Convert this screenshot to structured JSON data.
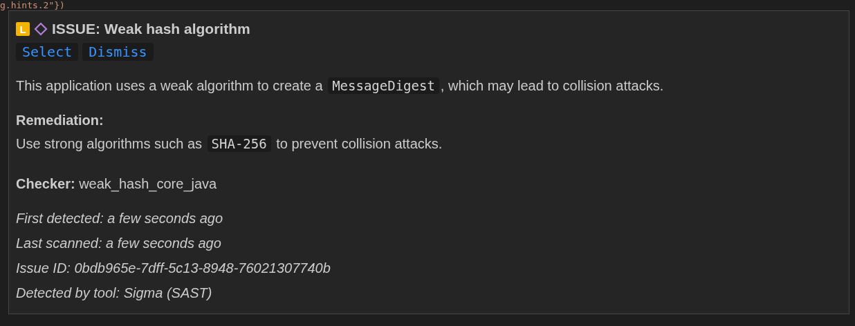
{
  "editor_code_line": "g.hints.2\"})",
  "hover": {
    "severity_badge": "L",
    "title": "ISSUE: Weak hash algorithm",
    "actions": [
      {
        "label": "Select"
      },
      {
        "label": "Dismiss"
      }
    ],
    "description": [
      {
        "kind": "text",
        "text": "This application uses a weak algorithm to create a "
      },
      {
        "kind": "code",
        "text": "MessageDigest"
      },
      {
        "kind": "text",
        "text": ", which may lead to collision attacks."
      }
    ],
    "remediation_label": "Remediation:",
    "remediation": [
      {
        "kind": "text",
        "text": "Use strong algorithms such as "
      },
      {
        "kind": "code",
        "text": "SHA-256"
      },
      {
        "kind": "text",
        "text": " to prevent collision attacks."
      }
    ],
    "checker_label": "Checker:",
    "checker": "weak_hash_core_java",
    "meta": [
      "First detected: a few seconds ago",
      "Last scanned: a few seconds ago",
      "Issue ID: 0bdb965e-7dff-5c13-8948-76021307740b",
      "Detected by tool: Sigma (SAST)"
    ]
  }
}
